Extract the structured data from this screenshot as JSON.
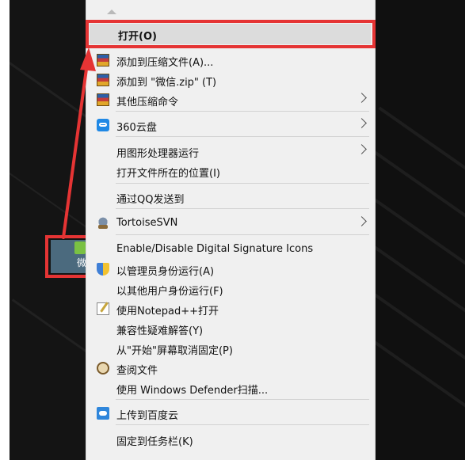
{
  "menu": {
    "open": "打开(O)",
    "items": [
      {
        "label": "添加到压缩文件(A)...",
        "icon": "winrar-icon"
      },
      {
        "label": "添加到 \"微信.zip\" (T)",
        "icon": "winrar-icon"
      },
      {
        "label": "其他压缩命令",
        "icon": "winrar-icon",
        "submenu": true
      },
      {
        "label": "360云盘",
        "icon": "360-cloud-icon",
        "submenu": true
      },
      {
        "label": "用图形处理器运行",
        "submenu": true
      },
      {
        "label": "打开文件所在的位置(I)"
      },
      {
        "label": "通过QQ发送到"
      },
      {
        "label": "TortoiseSVN",
        "icon": "tortoisesvn-icon",
        "submenu": true
      },
      {
        "label": "Enable/Disable Digital Signature Icons"
      },
      {
        "label": "以管理员身份运行(A)",
        "icon": "uac-shield-icon"
      },
      {
        "label": "以其他用户身份运行(F)"
      },
      {
        "label": "使用Notepad++打开",
        "icon": "notepad-plus-plus-icon"
      },
      {
        "label": "兼容性疑难解答(Y)"
      },
      {
        "label": "从\"开始\"屏幕取消固定(P)"
      },
      {
        "label": "查阅文件",
        "icon": "file-search-icon"
      },
      {
        "label": "使用 Windows Defender扫描..."
      },
      {
        "label": "上传到百度云",
        "icon": "baidu-cloud-icon"
      },
      {
        "label": "固定到任务栏(K)"
      }
    ]
  },
  "desktop_icon": {
    "label": "微"
  },
  "colors": {
    "highlight_red": "#e53434",
    "menu_bg": "#f0f0f0",
    "hover_bg": "#dcdcdc"
  }
}
